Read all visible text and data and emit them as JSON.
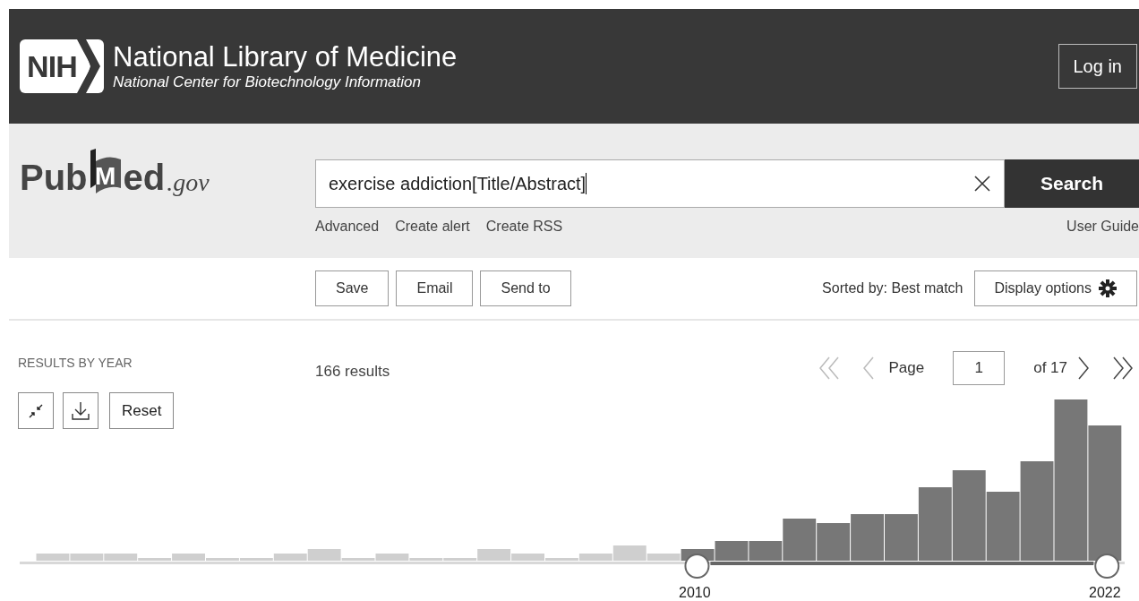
{
  "header": {
    "logo_text": "NIH",
    "title": "National Library of Medicine",
    "subtitle": "National Center for Biotechnology Information",
    "login_button": "Log in"
  },
  "search": {
    "logo_main": "Pub",
    "logo_m": "M",
    "logo_rest": "ed",
    "logo_domain": ".gov",
    "value": "exercise addiction[Title/Abstract]",
    "search_button": "Search",
    "links": [
      "Advanced",
      "Create alert",
      "Create RSS"
    ],
    "user_guide": "User Guide"
  },
  "actions": {
    "buttons": [
      "Save",
      "Email",
      "Send to"
    ],
    "sort_label": "Sorted by: Best match",
    "display_options": "Display options"
  },
  "timeline": {
    "heading": "RESULTS BY YEAR",
    "reset_button": "Reset",
    "start_label": "2010",
    "end_label": "2022",
    "handles": [
      {
        "level": 0.613
      },
      {
        "level": 0.984
      }
    ]
  },
  "results": {
    "count": "166 results",
    "page_label": "Page",
    "page_value": "1",
    "page_total": "of 17"
  }
}
